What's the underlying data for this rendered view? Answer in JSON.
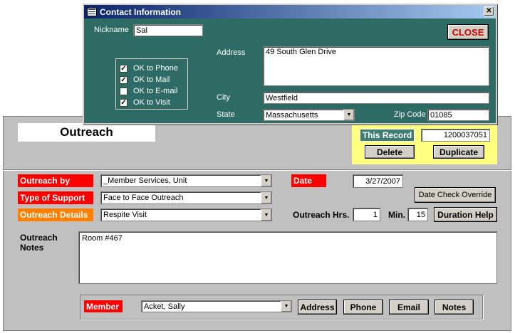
{
  "form": {
    "title": "Outreach",
    "record_label": "This Record",
    "record_id": "1200037051",
    "delete_label": "Delete",
    "duplicate_label": "Duplicate",
    "outreach_by_label": "Outreach by",
    "outreach_by_value": "_Member Services, Unit",
    "support_label": "Type of Support",
    "support_value": "Face to Face Outreach",
    "details_label": "Outreach Details",
    "details_value": "Respite Visit",
    "date_label": "Date",
    "date_value": "3/27/2007",
    "date_override_label": "Date Check Override",
    "hrs_label": "Outreach Hrs.",
    "hrs_value": "1",
    "min_label": "Min.",
    "min_value": "15",
    "duration_help_label": "Duration Help",
    "notes_label_1": "Outreach",
    "notes_label_2": "Notes",
    "notes_value": "Room #467",
    "member_label": "Member",
    "member_value": "Acket, Sally",
    "address_btn": "Address",
    "phone_btn": "Phone",
    "email_btn": "Email",
    "notes_btn": "Notes"
  },
  "dialog": {
    "title": "Contact Information",
    "close_x": "✕",
    "close_label": "CLOSE",
    "nickname_label": "Nickname",
    "nickname_value": "Sal",
    "address_label": "Address",
    "address_value": "49 South Glen Drive",
    "city_label": "City",
    "city_value": "Westfield",
    "state_label": "State",
    "state_value": "Massachusetts",
    "zip_label": "Zip Code",
    "zip_value": "01085",
    "ok_phone": "OK to Phone",
    "ok_mail": "OK to Mail",
    "ok_email": "OK to E-mail",
    "ok_visit": "OK to Visit",
    "ok_phone_checked": true,
    "ok_mail_checked": true,
    "ok_email_checked": false,
    "ok_visit_checked": true
  },
  "colors": {
    "dialog_bg": "#2f6b65",
    "required_label": "#ff0000",
    "details_label": "#ff8000",
    "record_panel": "#ffff80",
    "close_text": "#d00000"
  }
}
